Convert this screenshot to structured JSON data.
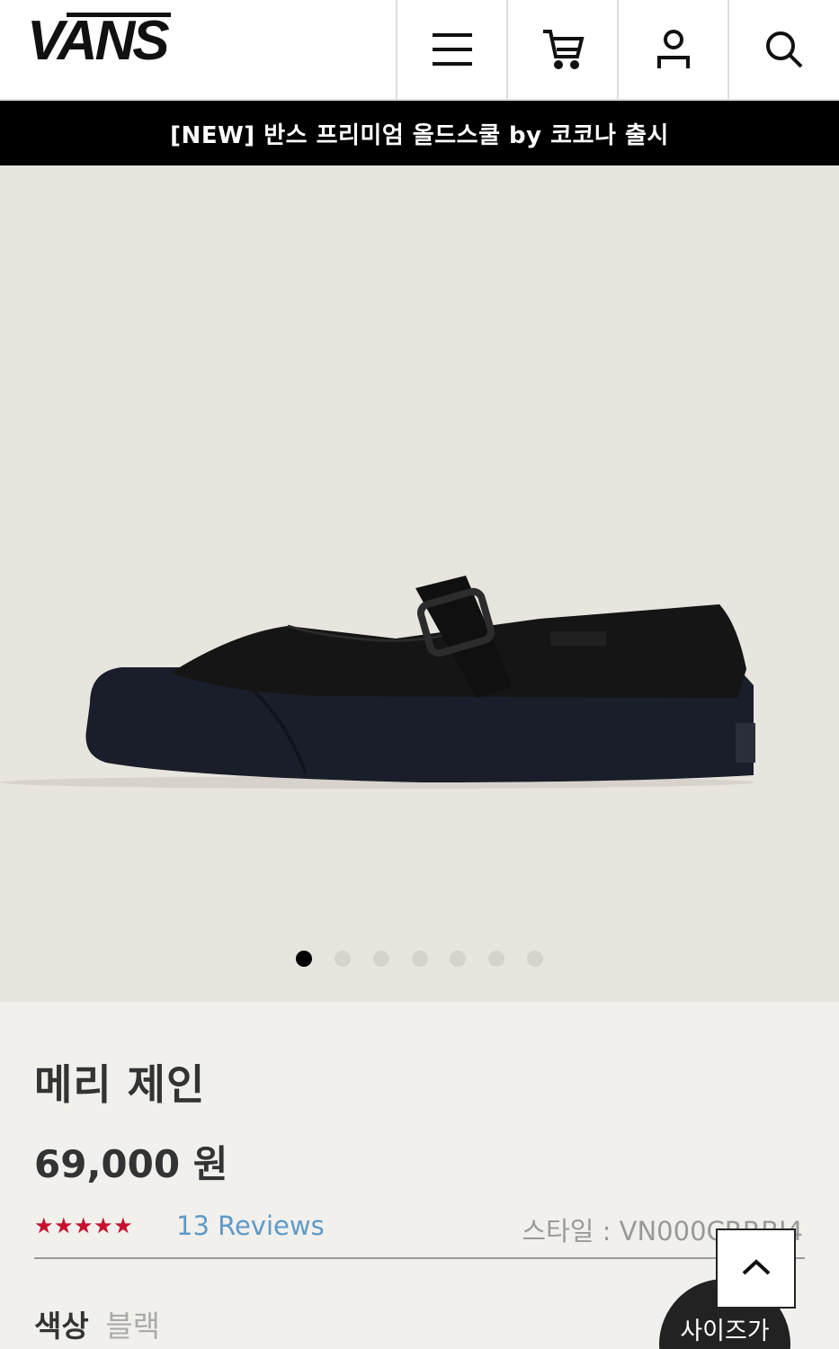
{
  "header": {
    "logo_text": "VANS",
    "icons": [
      "menu-icon",
      "cart-icon",
      "account-icon",
      "search-icon"
    ]
  },
  "promo": {
    "text": "[NEW] 반스 프리미엄 올드스쿨 by 코코나 출시"
  },
  "gallery": {
    "slide_count": 7,
    "active_index": 0,
    "background": "#e8e5df"
  },
  "product": {
    "name": "메리 제인",
    "price": "69,000 원",
    "rating": 4.6,
    "rating_max": 5,
    "reviews_label": "13 Reviews",
    "style_label": "스타일 : VN000CRRBJ4",
    "color_label": "색상",
    "color_value": "블랙"
  },
  "floating": {
    "size_button_label": "사이즈가"
  },
  "colors": {
    "star": "#c8102e",
    "link": "#5f9ac8",
    "banner": "#000000"
  }
}
